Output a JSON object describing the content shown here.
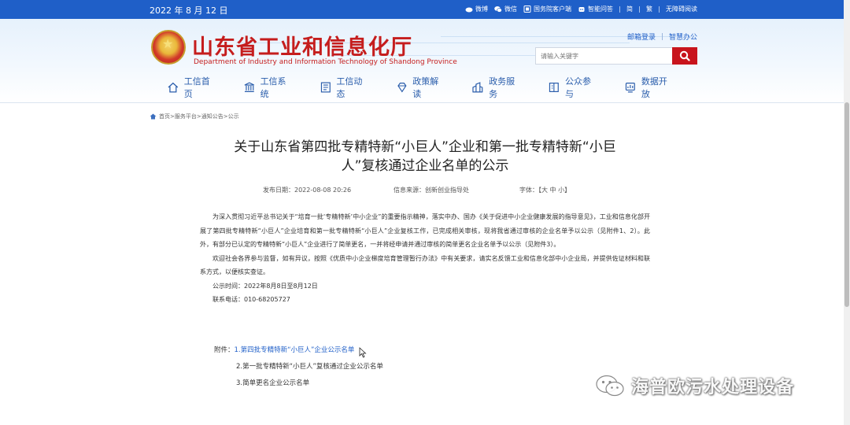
{
  "topbar": {
    "date": "2022 年 8 月 12 日",
    "links": [
      "微博",
      "微信",
      "国务院客户端",
      "智能问答",
      "简",
      "繁",
      "无障碍阅读"
    ]
  },
  "header": {
    "site_name": "山东省工业和信息化厅",
    "site_name_en": "Department of Industry and Information Technology of Shandong Province",
    "links": [
      "邮箱登录",
      "智慧办公"
    ],
    "search_placeholder": "请输入关键字"
  },
  "nav": {
    "items": [
      {
        "label": "工信首页",
        "icon": "home-icon"
      },
      {
        "label": "工信系统",
        "icon": "building-icon"
      },
      {
        "label": "工信动态",
        "icon": "news-icon"
      },
      {
        "label": "政策解读",
        "icon": "diamond-icon"
      },
      {
        "label": "政务服务",
        "icon": "service-icon"
      },
      {
        "label": "公众参与",
        "icon": "participate-icon"
      },
      {
        "label": "数据开放",
        "icon": "data-icon"
      }
    ]
  },
  "breadcrumb": {
    "text": "首页>服务平台>通知公告>公示"
  },
  "article": {
    "title_line1": "关于山东省第四批专精特新“小巨人”企业和第一批专精特新“小巨",
    "title_line2": "人”复核通过企业名单的公示",
    "publish_date": "发布日期：2022-08-08 20:26",
    "source": "信息来源：创新创业指导处",
    "font_size": "字体：【大 中 小】",
    "paragraph1": "为深入贯彻习近平总书记关于“培育一批‘专精特新’中小企业”的重要指示精神，落实中办、国办《关于促进中小企业健康发展的指导意见》，工业和信息化部开展了第四批专精特新“小巨人”企业培育和第一批专精特新“小巨人”企业复核工作，已完成相关审核，现将我省通过审核的企业名单予以公示（见附件1、2）。此外，有部分已认定的专精特新“小巨人”企业进行了简单更名，一并将经申请并通过审核的简单更名企业名单予以公示（见附件3）。",
    "paragraph2": "欢迎社会各界参与监督，如有异议，按照《优质中小企业梯度培育管理暂行办法》中有关要求，请实名反馈工业和信息化部中小企业局，并提供佐证材料和联系方式，以便核实查证。",
    "period": "公示时间：2022年8月8日至8月12日",
    "phone": "联系电话：010-68205727",
    "attach_label": "附件：",
    "attachments": [
      "1.第四批专精特新“小巨人”企业公示名单",
      "2.第一批专精特新“小巨人”复核通过企业公示名单",
      "3.简单更名企业公示名单"
    ]
  },
  "watermark": {
    "text": "海普欧污水处理设备"
  }
}
